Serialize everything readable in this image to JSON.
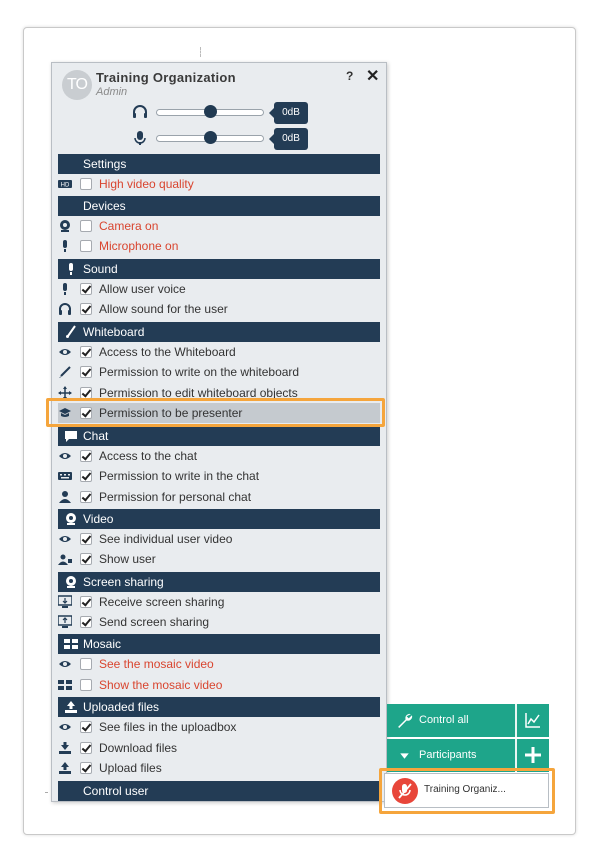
{
  "header": {
    "avatar_initials": "TO",
    "org_name": "Training Organization",
    "role": "Admin",
    "help_label": "?",
    "close_label": "✕"
  },
  "volume": {
    "speaker_level": 0.5,
    "speaker_db": "0dB",
    "mic_level": 0.5,
    "mic_db": "0dB"
  },
  "sections": {
    "settings": "Settings",
    "devices": "Devices",
    "sound": "Sound",
    "whiteboard": "Whiteboard",
    "chat": "Chat",
    "video": "Video",
    "screen_sharing": "Screen sharing",
    "mosaic": "Mosaic",
    "uploaded_files": "Uploaded files",
    "control_user": "Control user"
  },
  "options": {
    "high_video_quality": {
      "label": "High video quality",
      "checked": false
    },
    "camera_on": {
      "label": "Camera on",
      "checked": false
    },
    "microphone_on": {
      "label": "Microphone on",
      "checked": false
    },
    "allow_user_voice": {
      "label": "Allow user voice",
      "checked": true
    },
    "allow_sound": {
      "label": "Allow sound for the user",
      "checked": true
    },
    "access_whiteboard": {
      "label": "Access to the Whiteboard",
      "checked": true
    },
    "write_whiteboard": {
      "label": "Permission to write on the whiteboard",
      "checked": true
    },
    "edit_whiteboard": {
      "label": "Permission to edit whiteboard objects",
      "checked": true
    },
    "presenter": {
      "label": "Permission to be presenter",
      "checked": true
    },
    "access_chat": {
      "label": "Access to the chat",
      "checked": true
    },
    "write_chat": {
      "label": "Permission to write in the chat",
      "checked": true
    },
    "personal_chat": {
      "label": "Permission for personal chat",
      "checked": true
    },
    "see_video": {
      "label": "See individual user video",
      "checked": true
    },
    "show_user": {
      "label": "Show user",
      "checked": true
    },
    "receive_screen": {
      "label": "Receive screen sharing",
      "checked": true
    },
    "send_screen": {
      "label": "Send screen sharing",
      "checked": true
    },
    "see_mosaic": {
      "label": "See the mosaic video",
      "checked": false
    },
    "show_mosaic": {
      "label": "Show the mosaic video",
      "checked": false
    },
    "see_files": {
      "label": "See files in the uploadbox",
      "checked": true
    },
    "download_files": {
      "label": "Download files",
      "checked": true
    },
    "upload_files": {
      "label": "Upload files",
      "checked": true
    }
  },
  "side_controls": {
    "control_all": "Control all",
    "participants": "Participants",
    "participant_name": "Training Organiz..."
  },
  "colors": {
    "section_bar": "#233c55",
    "disabled_text": "#d9452f",
    "accent_green": "#1ea58a",
    "highlight": "#f5a53c"
  }
}
